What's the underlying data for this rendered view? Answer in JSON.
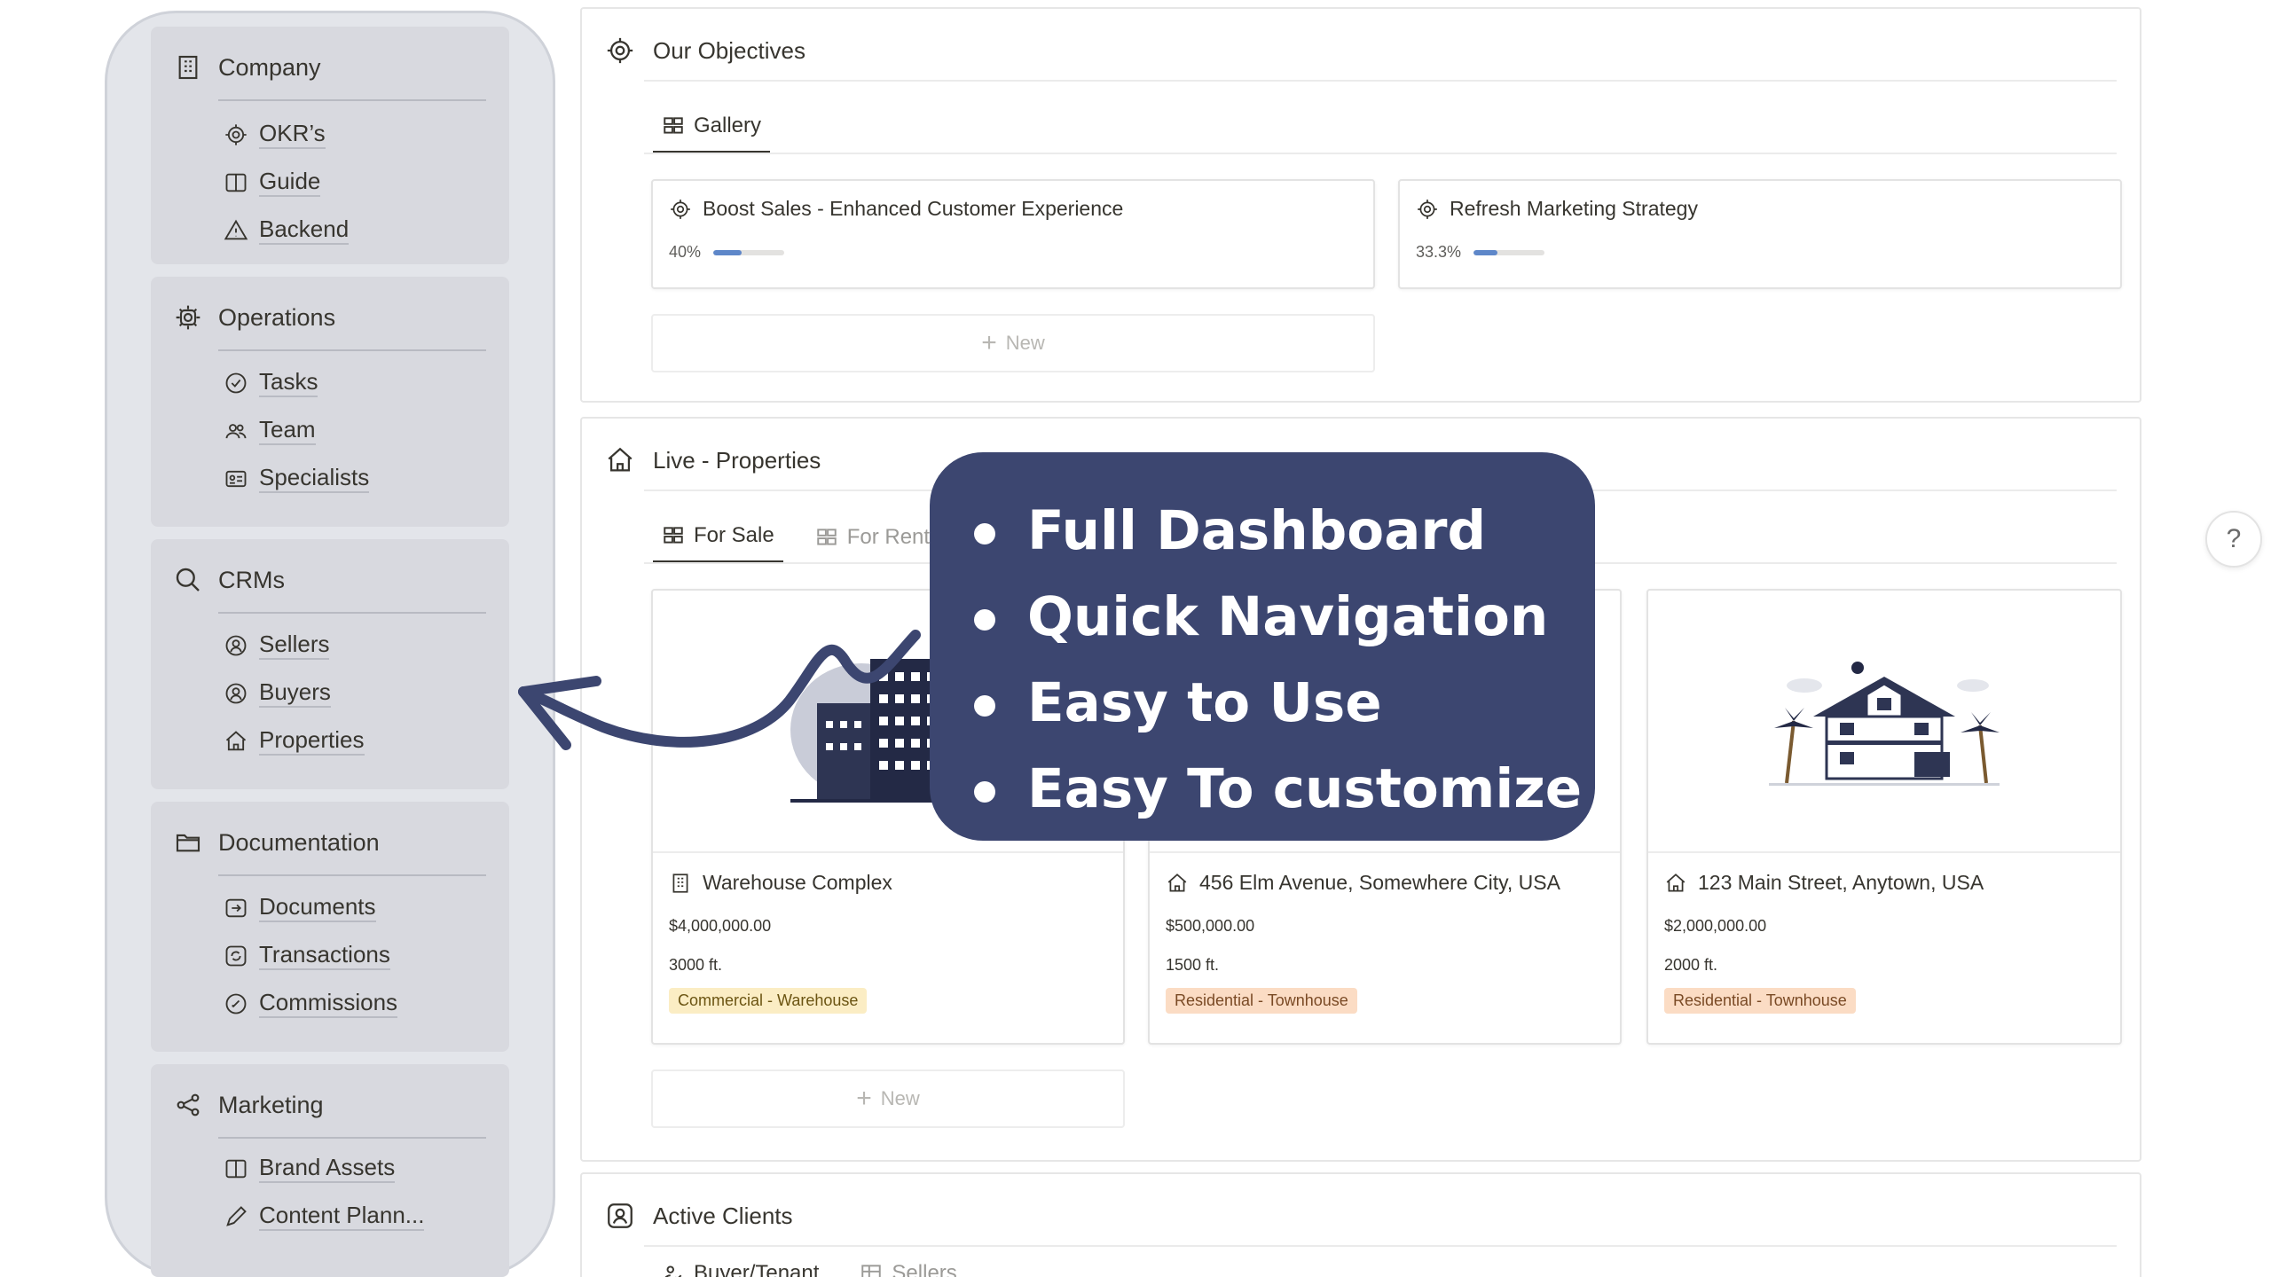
{
  "sidebar": {
    "sections": [
      {
        "label": "Company",
        "icon": "building-icon",
        "items": [
          {
            "label": "OKR’s",
            "icon": "target-icon"
          },
          {
            "label": "Guide",
            "icon": "book-icon"
          },
          {
            "label": "Backend",
            "icon": "warning-icon"
          }
        ]
      },
      {
        "label": "Operations",
        "icon": "gear-icon",
        "items": [
          {
            "label": "Tasks",
            "icon": "check-circle-icon"
          },
          {
            "label": "Team",
            "icon": "people-icon"
          },
          {
            "label": "Specialists",
            "icon": "id-card-icon"
          }
        ]
      },
      {
        "label": "CRMs",
        "icon": "search-icon",
        "items": [
          {
            "label": "Sellers",
            "icon": "user-circle-icon"
          },
          {
            "label": "Buyers",
            "icon": "user-circle-icon"
          },
          {
            "label": "Properties",
            "icon": "house-icon"
          }
        ]
      },
      {
        "label": "Documentation",
        "icon": "folder-icon",
        "items": [
          {
            "label": "Documents",
            "icon": "file-arrow-icon"
          },
          {
            "label": "Transactions",
            "icon": "refresh-icon"
          },
          {
            "label": "Commissions",
            "icon": "edit-circle-icon"
          }
        ]
      },
      {
        "label": "Marketing",
        "icon": "share-icon",
        "items": [
          {
            "label": "Brand Assets",
            "icon": "book-icon"
          },
          {
            "label": "Content Plann...",
            "icon": "pencil-icon"
          }
        ]
      }
    ]
  },
  "objectives": {
    "title": "Our Objectives",
    "tab": "Gallery",
    "cards": [
      {
        "title": "Boost Sales - Enhanced Customer Experience",
        "progress_label": "40%",
        "progress": 0.4
      },
      {
        "title": "Refresh Marketing Strategy",
        "progress_label": "33.3%",
        "progress": 0.333
      }
    ],
    "new_label": "New"
  },
  "properties": {
    "title": "Live - Properties",
    "tabs": [
      "For Sale",
      "For Rent"
    ],
    "cards": [
      {
        "title": "Warehouse Complex",
        "price": "$4,000,000.00",
        "size": "3000 ft.",
        "tag": "Commercial - Warehouse",
        "tag_bg": "#fbedc4",
        "tag_fg": "#6b5412",
        "icon": "building-icon"
      },
      {
        "title": "456 Elm Avenue, Somewhere City, USA",
        "price": "$500,000.00",
        "size": "1500 ft.",
        "tag": "Residential - Townhouse",
        "tag_bg": "#fbdcc4",
        "tag_fg": "#7a4a25",
        "icon": "house-icon"
      },
      {
        "title": "123 Main Street, Anytown, USA",
        "price": "$2,000,000.00",
        "size": "2000 ft.",
        "tag": "Residential - Townhouse",
        "tag_bg": "#fbdcc4",
        "tag_fg": "#7a4a25",
        "icon": "house-icon"
      }
    ],
    "new_label": "New"
  },
  "clients": {
    "title": "Active Clients",
    "tabs": [
      "Buyer/Tenant",
      "Sellers"
    ]
  },
  "callout": {
    "bullets": [
      "Full Dashboard",
      "Quick Navigation",
      "Easy to Use",
      "Easy To customize"
    ],
    "bg": "#3c4670"
  },
  "help": {
    "label": "?"
  }
}
